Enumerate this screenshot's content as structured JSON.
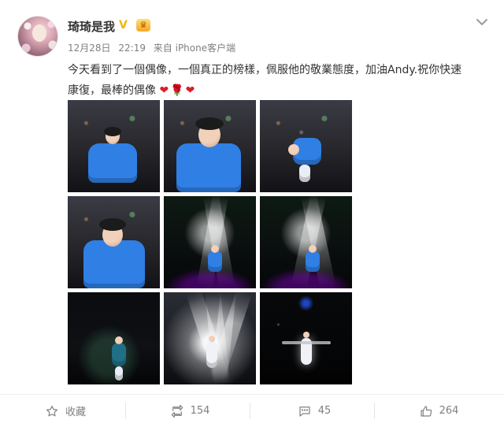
{
  "post": {
    "username": "琦琦是我",
    "badges": {
      "vip": "V",
      "crown": "♛"
    },
    "meta": {
      "date": "12月28日",
      "time": "22:19",
      "source": "来自 iPhone客户端"
    },
    "text": {
      "line1": "今天看到了一個偶像，一個真正的榜樣，佩服他的敬業態度，加油Andy.祝你快速",
      "line2": "康復，最棒的偶像",
      "emojis": "❤🌹❤"
    }
  },
  "actions": {
    "favorite": "收藏",
    "repost_count": "154",
    "comment_count": "45",
    "like_count": "264"
  },
  "colors": {
    "text": "#333333",
    "meta": "#808080",
    "vip": "#f2b600",
    "divider": "#eeeeee",
    "accent_red": "#d81e28"
  },
  "icons": {
    "dropdown": "chevron-down-icon",
    "favorite": "star-icon",
    "repost": "repost-icon",
    "comment": "comment-icon",
    "like": "thumbs-up-icon"
  }
}
